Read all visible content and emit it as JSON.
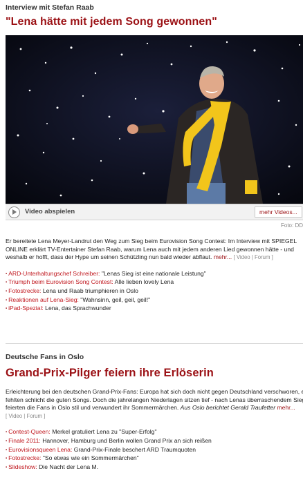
{
  "article1": {
    "kicker": "Interview mit Stefan Raab",
    "headline": "\"Lena hätte mit jedem Song gewonnen\"",
    "video": {
      "play_label": "Video abspielen",
      "more_label": "mehr Videos...",
      "credit": "Foto: DD"
    },
    "teaser": "Er bereitete Lena Meyer-Landrut den Weg zum Sieg beim Eurovision Song Contest: Im Interview mit SPIEGEL ONLINE erklärt TV-Entertainer Stefan Raab, warum Lena auch mit jedem anderen Lied gewonnen hätte - und weshalb er hofft, dass der Hype um seinen Schützling nun bald wieder abflaut.",
    "more": "mehr...",
    "meta": "[ Video | Forum ]",
    "links": [
      {
        "link": "ARD-Unterhaltungschef Schreiber:",
        "text": " \"Lenas Sieg ist eine nationale Leistung\""
      },
      {
        "link": "Triumph beim Eurovision Song Contest:",
        "text": " Alle lieben lovely Lena"
      },
      {
        "link": "Fotostrecke:",
        "text": " Lena und Raab triumphieren in Oslo"
      },
      {
        "link": "Reaktionen auf Lena-Sieg:",
        "text": " \"Wahnsinn, geil, geil, geil!\""
      },
      {
        "link": "iPad-Spezial:",
        "text": " Lena, das Sprachwunder"
      }
    ]
  },
  "article2": {
    "kicker": "Deutsche Fans in Oslo",
    "headline": "Grand-Prix-Pilger feiern ihre Erlöserin",
    "teaser": "Erleichterung bei den deutschen Grand-Prix-Fans: Europa hat sich doch nicht gegen Deutschland verschworen, es fehlten schlicht die guten Songs. Doch die jahrelangen Niederlagen sitzen tief - nach Lenas überraschendem Sieg feierten die Fans in Oslo stil und verwundert ihr Sommermärchen.",
    "byline": "Aus Oslo berichtet Gerald Traufetter",
    "more": "mehr...",
    "meta": "[ Video | Forum ]",
    "links": [
      {
        "link": "Contest-Queen:",
        "text": " Merkel gratuliert Lena zu \"Super-Erfolg\""
      },
      {
        "link": "Finale 2011:",
        "text": " Hannover, Hamburg und Berlin wollen Grand Prix an sich reißen"
      },
      {
        "link": "Eurovisionsqueen Lena:",
        "text": " Grand-Prix-Finale beschert ARD Traumquoten"
      },
      {
        "link": "Fotostrecke:",
        "text": " \"So etwas wie ein Sommermärchen\""
      },
      {
        "link": "Slideshow:",
        "text": " Die Nacht der Lena M."
      }
    ]
  },
  "colors": {
    "accent": "#9b1115",
    "link": "#c0161d",
    "scarf": "#f2c51b"
  }
}
